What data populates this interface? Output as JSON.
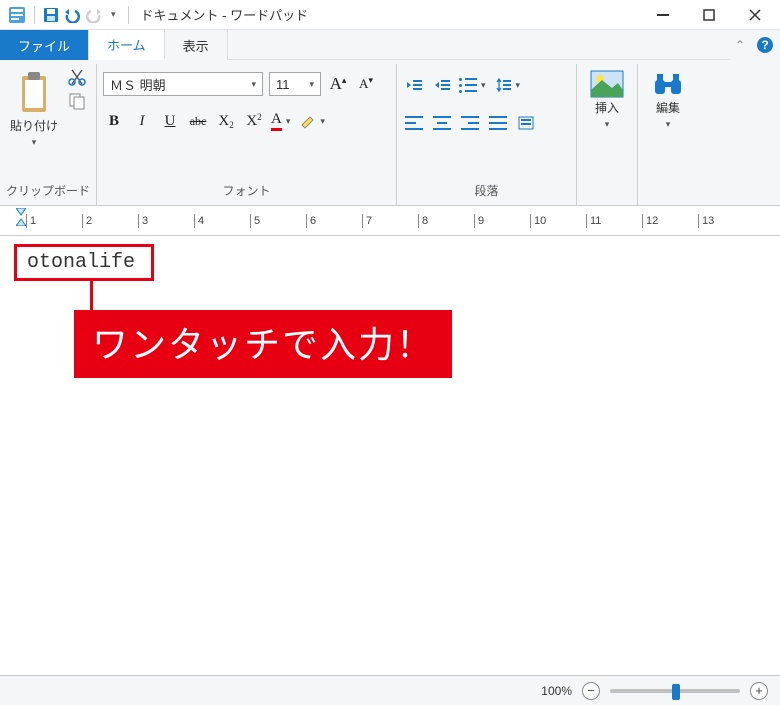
{
  "titlebar": {
    "title": "ドキュメント - ワードパッド"
  },
  "tabs": {
    "file": "ファイル",
    "home": "ホーム",
    "view": "表示"
  },
  "ribbon": {
    "clipboard": {
      "paste": "貼り付け",
      "group_label": "クリップボード"
    },
    "font": {
      "name": "ＭＳ 明朝",
      "size": "11",
      "group_label": "フォント",
      "bold": "B",
      "italic": "I",
      "underline": "U",
      "strike": "abc",
      "sub_x": "X",
      "sup_x": "X",
      "font_a": "A",
      "highlight_a": "A"
    },
    "paragraph": {
      "group_label": "段落"
    },
    "insert": {
      "label": "挿入"
    },
    "edit": {
      "label": "編集"
    }
  },
  "document": {
    "typed_text": "otonalife",
    "callout": "ワンタッチで入力！"
  },
  "statusbar": {
    "zoom_percent": "100%"
  },
  "ruler": {
    "marks": [
      1,
      2,
      3,
      4,
      5,
      6,
      7,
      8,
      9,
      10,
      11,
      12,
      13
    ]
  }
}
